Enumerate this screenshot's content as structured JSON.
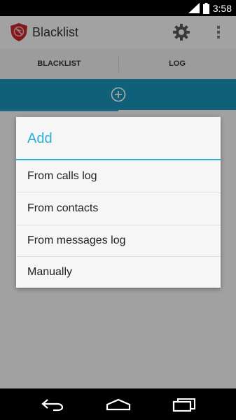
{
  "status_bar": {
    "time": "3:58",
    "icons": [
      "signal-icon",
      "battery-icon"
    ]
  },
  "action_bar": {
    "title": "Blacklist",
    "app_icon": "shield-icon",
    "actions": [
      "gear-icon",
      "overflow-menu-icon"
    ]
  },
  "tabs": [
    {
      "label": "BLACKLIST",
      "selected": true
    },
    {
      "label": "LOG",
      "selected": false
    }
  ],
  "add_bar": {
    "icon": "add-circle-icon"
  },
  "dialog": {
    "title": "Add",
    "items": [
      {
        "label": "From calls log"
      },
      {
        "label": "From contacts"
      },
      {
        "label": "From messages log"
      },
      {
        "label": "Manually"
      }
    ]
  },
  "nav_bar": {
    "buttons": [
      "back-icon",
      "home-icon",
      "recents-icon"
    ]
  },
  "colors": {
    "accent": "#2bb0d6",
    "add_bar": "#1a8fb5",
    "tab_indicator": "#2aa0c4",
    "app_icon": "#c0262c"
  }
}
